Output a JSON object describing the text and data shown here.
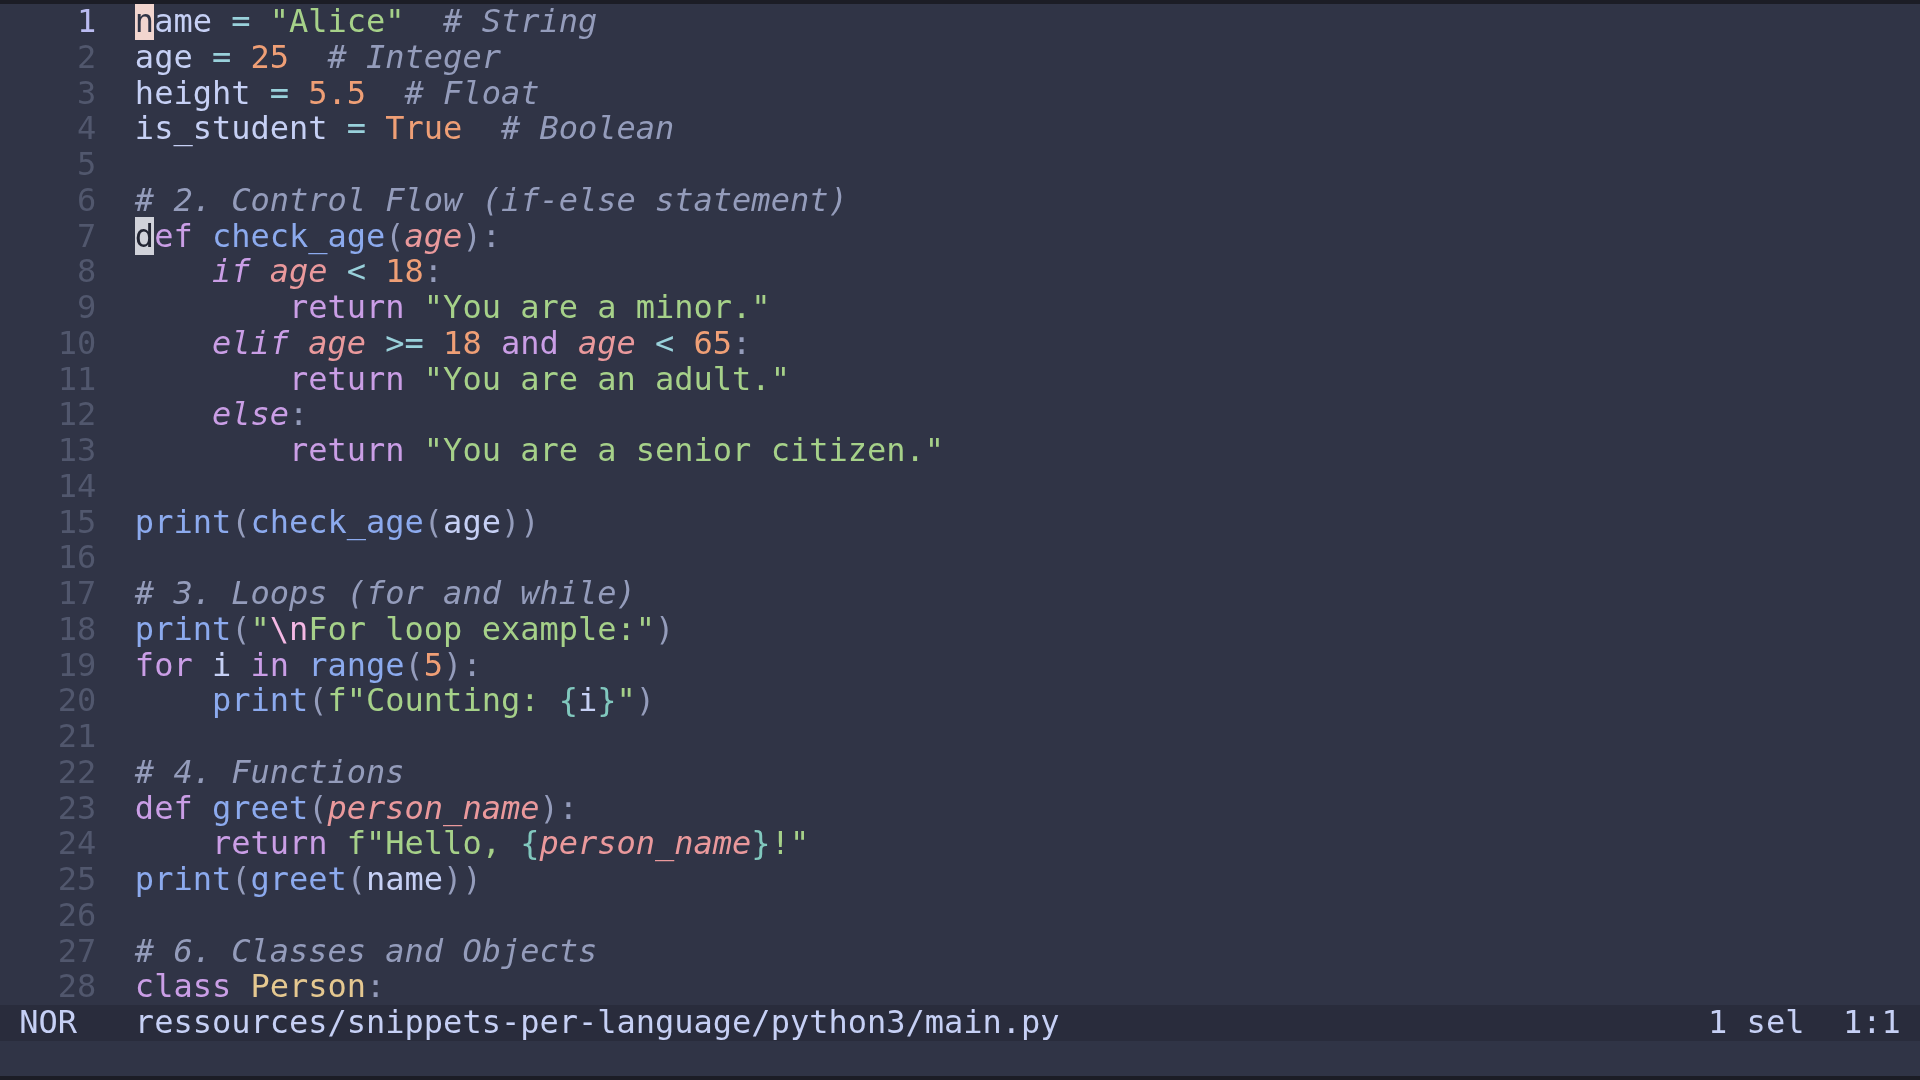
{
  "lines": [
    {
      "number": "1",
      "current": true,
      "tokens": [
        {
          "text": "n",
          "kind": "cursor"
        },
        {
          "text": "ame",
          "kind": "variable"
        },
        {
          "text": " = ",
          "kind": "operator"
        },
        {
          "text": "\"Alice\"",
          "kind": "string"
        },
        {
          "text": "  # String",
          "kind": "comment"
        }
      ]
    },
    {
      "number": "2",
      "current": false,
      "tokens": [
        {
          "text": "age",
          "kind": "variable"
        },
        {
          "text": " = ",
          "kind": "operator"
        },
        {
          "text": "25",
          "kind": "number"
        },
        {
          "text": "  # Integer",
          "kind": "comment"
        }
      ]
    },
    {
      "number": "3",
      "current": false,
      "tokens": [
        {
          "text": "height",
          "kind": "variable"
        },
        {
          "text": " = ",
          "kind": "operator"
        },
        {
          "text": "5.5",
          "kind": "number"
        },
        {
          "text": "  # Float",
          "kind": "comment"
        }
      ]
    },
    {
      "number": "4",
      "current": false,
      "tokens": [
        {
          "text": "is_student",
          "kind": "variable"
        },
        {
          "text": " = ",
          "kind": "operator"
        },
        {
          "text": "True",
          "kind": "constant"
        },
        {
          "text": "  # Boolean",
          "kind": "comment"
        }
      ]
    },
    {
      "number": "5",
      "current": false
    },
    {
      "number": "6",
      "current": false,
      "tokens": [
        {
          "text": "# 2. Control Flow (if-else statement)",
          "kind": "comment"
        }
      ]
    },
    {
      "number": "7",
      "current": false,
      "tokens": [
        {
          "text": "d",
          "kind": "mark"
        },
        {
          "text": "ef ",
          "kind": "keyword"
        },
        {
          "text": "check_age",
          "kind": "function"
        },
        {
          "text": "(",
          "kind": "punctuation"
        },
        {
          "text": "age",
          "kind": "parameter"
        },
        {
          "text": "):",
          "kind": "punctuation"
        }
      ]
    },
    {
      "number": "8",
      "current": false,
      "tokens": [
        {
          "text": "    if ",
          "kind": "conditional"
        },
        {
          "text": "age",
          "kind": "parameter"
        },
        {
          "text": " < ",
          "kind": "operator"
        },
        {
          "text": "18",
          "kind": "number"
        },
        {
          "text": ":",
          "kind": "punctuation"
        }
      ]
    },
    {
      "number": "9",
      "current": false,
      "tokens": [
        {
          "text": "        return ",
          "kind": "keyword"
        },
        {
          "text": "\"You are a minor.\"",
          "kind": "string"
        }
      ]
    },
    {
      "number": "10",
      "current": false,
      "tokens": [
        {
          "text": "    elif ",
          "kind": "conditional"
        },
        {
          "text": "age",
          "kind": "parameter"
        },
        {
          "text": " >= ",
          "kind": "operator"
        },
        {
          "text": "18",
          "kind": "number"
        },
        {
          "text": " and ",
          "kind": "keyword"
        },
        {
          "text": "age",
          "kind": "parameter"
        },
        {
          "text": " < ",
          "kind": "operator"
        },
        {
          "text": "65",
          "kind": "number"
        },
        {
          "text": ":",
          "kind": "punctuation"
        }
      ]
    },
    {
      "number": "11",
      "current": false,
      "tokens": [
        {
          "text": "        return ",
          "kind": "keyword"
        },
        {
          "text": "\"You are an adult.\"",
          "kind": "string"
        }
      ]
    },
    {
      "number": "12",
      "current": false,
      "tokens": [
        {
          "text": "    else",
          "kind": "conditional"
        },
        {
          "text": ":",
          "kind": "punctuation"
        }
      ]
    },
    {
      "number": "13",
      "current": false,
      "tokens": [
        {
          "text": "        return ",
          "kind": "keyword"
        },
        {
          "text": "\"You are a senior citizen.\"",
          "kind": "string"
        }
      ]
    },
    {
      "number": "14",
      "current": false
    },
    {
      "number": "15",
      "current": false,
      "tokens": [
        {
          "text": "print",
          "kind": "function"
        },
        {
          "text": "(",
          "kind": "punctuation"
        },
        {
          "text": "check_age",
          "kind": "function"
        },
        {
          "text": "(",
          "kind": "punctuation"
        },
        {
          "text": "age",
          "kind": "variable"
        },
        {
          "text": "))",
          "kind": "punctuation"
        }
      ]
    },
    {
      "number": "16",
      "current": false
    },
    {
      "number": "17",
      "current": false,
      "tokens": [
        {
          "text": "# 3. Loops (for and while)",
          "kind": "comment"
        }
      ]
    },
    {
      "number": "18",
      "current": false,
      "tokens": [
        {
          "text": "print",
          "kind": "function"
        },
        {
          "text": "(",
          "kind": "punctuation"
        },
        {
          "text": "\"",
          "kind": "string"
        },
        {
          "text": "\\n",
          "kind": "escape"
        },
        {
          "text": "For loop example:\"",
          "kind": "string"
        },
        {
          "text": ")",
          "kind": "punctuation"
        }
      ]
    },
    {
      "number": "19",
      "current": false,
      "tokens": [
        {
          "text": "for",
          "kind": "keyword"
        },
        {
          "text": " i ",
          "kind": "variable"
        },
        {
          "text": "in ",
          "kind": "keyword"
        },
        {
          "text": "range",
          "kind": "function"
        },
        {
          "text": "(",
          "kind": "punctuation"
        },
        {
          "text": "5",
          "kind": "number"
        },
        {
          "text": "):",
          "kind": "punctuation"
        }
      ]
    },
    {
      "number": "20",
      "current": false,
      "tokens": [
        {
          "text": "    print",
          "kind": "function"
        },
        {
          "text": "(",
          "kind": "punctuation"
        },
        {
          "text": "f\"Counting: ",
          "kind": "string"
        },
        {
          "text": "{",
          "kind": "interpolation"
        },
        {
          "text": "i",
          "kind": "variable"
        },
        {
          "text": "}",
          "kind": "interpolation"
        },
        {
          "text": "\"",
          "kind": "string"
        },
        {
          "text": ")",
          "kind": "punctuation"
        }
      ]
    },
    {
      "number": "21",
      "current": false
    },
    {
      "number": "22",
      "current": false,
      "tokens": [
        {
          "text": "# 4. Functions",
          "kind": "comment"
        }
      ]
    },
    {
      "number": "23",
      "current": false,
      "tokens": [
        {
          "text": "def ",
          "kind": "keyword"
        },
        {
          "text": "greet",
          "kind": "function"
        },
        {
          "text": "(",
          "kind": "punctuation"
        },
        {
          "text": "person_name",
          "kind": "parameter"
        },
        {
          "text": "):",
          "kind": "punctuation"
        }
      ]
    },
    {
      "number": "24",
      "current": false,
      "tokens": [
        {
          "text": "    return ",
          "kind": "keyword"
        },
        {
          "text": "f\"Hello, ",
          "kind": "string"
        },
        {
          "text": "{",
          "kind": "interpolation"
        },
        {
          "text": "person_name",
          "kind": "parameter"
        },
        {
          "text": "}",
          "kind": "interpolation"
        },
        {
          "text": "!\"",
          "kind": "string"
        }
      ]
    },
    {
      "number": "25",
      "current": false,
      "tokens": [
        {
          "text": "print",
          "kind": "function"
        },
        {
          "text": "(",
          "kind": "punctuation"
        },
        {
          "text": "greet",
          "kind": "function"
        },
        {
          "text": "(",
          "kind": "punctuation"
        },
        {
          "text": "name",
          "kind": "variable"
        },
        {
          "text": "))",
          "kind": "punctuation"
        }
      ]
    },
    {
      "number": "26",
      "current": false
    },
    {
      "number": "27",
      "current": false,
      "tokens": [
        {
          "text": "# 6. Classes and Objects",
          "kind": "comment"
        }
      ]
    },
    {
      "number": "28",
      "current": false,
      "tokens": [
        {
          "text": "class ",
          "kind": "keyword"
        },
        {
          "text": "Person",
          "kind": "type"
        },
        {
          "text": ":",
          "kind": "punctuation"
        }
      ]
    }
  ],
  "status_bar": {
    "mode": "NOR",
    "file_path": "ressources/snippets-per-language/python3/main.py",
    "selections": "1 sel",
    "position": "1:1"
  }
}
